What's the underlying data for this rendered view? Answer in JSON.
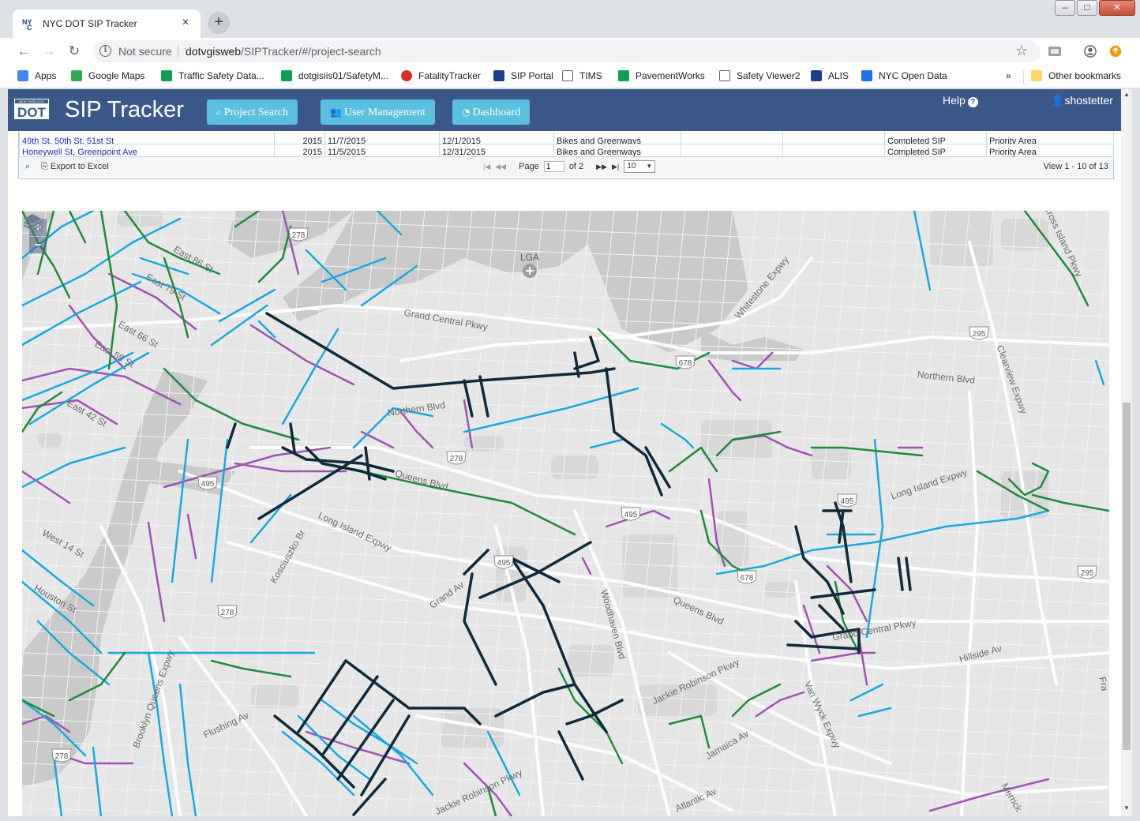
{
  "browser": {
    "tab_title": "NYC DOT SIP Tracker",
    "tab_close": "×",
    "new_tab": "+",
    "window_controls": {
      "minimize": "–",
      "maximize": "□",
      "close": "✕"
    },
    "security_label": "Not secure",
    "url_host": "dotvgisweb",
    "url_path": "/SIPTracker/#/project-search",
    "bookmarks": [
      {
        "label": "Apps",
        "icon": "apps-grid-icon",
        "color": "#4285f4"
      },
      {
        "label": "Google Maps",
        "icon": "google-maps-icon",
        "color": "#34a853"
      },
      {
        "label": "Traffic Safety Data...",
        "icon": "traffic-icon",
        "color": "#0f9d58"
      },
      {
        "label": "dotgisiis01/SafetyM...",
        "icon": "traffic-icon",
        "color": "#0f9d58"
      },
      {
        "label": "FatalityTracker",
        "icon": "fatality-tracker-icon",
        "color": "#d93025"
      },
      {
        "label": "SIP Portal",
        "icon": "nyc-icon",
        "color": "#1a3e8c"
      },
      {
        "label": "TIMS",
        "icon": "page-icon",
        "color": "#ffffff"
      },
      {
        "label": "PavementWorks",
        "icon": "pavement-icon",
        "color": "#0f9d58"
      },
      {
        "label": "Safety Viewer2",
        "icon": "page-icon",
        "color": "#ffffff"
      },
      {
        "label": "ALIS",
        "icon": "alis-icon",
        "color": "#1a3e8c"
      },
      {
        "label": "NYC Open Data",
        "icon": "open-data-icon",
        "color": "#1a73e8"
      }
    ],
    "bookmarks_more": "»",
    "other_bookmarks": "Other bookmarks"
  },
  "app": {
    "logo_top": "NEW YORK CITY",
    "logo_main": "DOT",
    "title": "SIP Tracker",
    "nav": [
      {
        "label": "Project Search",
        "icon": "search-icon"
      },
      {
        "label": "User Management",
        "icon": "users-icon"
      },
      {
        "label": "Dashboard",
        "icon": "dashboard-icon"
      }
    ],
    "help_label": "Help",
    "user_name": "shostetter"
  },
  "grid": {
    "rows": [
      {
        "name": "49th St, 50th St, 51st St",
        "year": "2015",
        "start": "11/7/2015",
        "end": "12/1/2015",
        "type": "Bikes and Greenways",
        "c6": "",
        "c7": "",
        "status": "Completed SIP",
        "area": "Priority Area"
      },
      {
        "name": "Honeywell St, Greenpoint Ave",
        "year": "2015",
        "start": "11/5/2015",
        "end": "12/31/2015",
        "type": "Bikes and Greenways",
        "c6": "",
        "c7": "",
        "status": "Completed SIP",
        "area": "Priority Area"
      }
    ],
    "pager": {
      "export_label": "Export to Excel",
      "page_label": "Page",
      "page_value": "1",
      "of_label": "of 2",
      "rows_per_page": "10",
      "view_label": "View 1 - 10 of 13"
    }
  },
  "map": {
    "zoom_in": "+",
    "zoom_out": "−",
    "colors": {
      "background": "#e6e6e6",
      "water": "#c9c9c9",
      "park": "#d8d8d8",
      "road": "#ffffff",
      "dark_project": "#0e2a3b",
      "blue_project": "#16a8e0",
      "green_project": "#1e8a3a",
      "purple_project": "#a050b4"
    },
    "labels": [
      {
        "text": "LGA",
        "kind": "airport"
      },
      {
        "text": "Grand Central Pkwy"
      },
      {
        "text": "Whitestone Expwy"
      },
      {
        "text": "Northern Blvd"
      },
      {
        "text": "Northern Blvd"
      },
      {
        "text": "Clearview Expwy"
      },
      {
        "text": "Cross Island Pkwy"
      },
      {
        "text": "Queens Blvd"
      },
      {
        "text": "Long Island Expwy"
      },
      {
        "text": "Long Island Expwy"
      },
      {
        "text": "Kosciuszko Br"
      },
      {
        "text": "Grand Av"
      },
      {
        "text": "Woodhaven Blvd"
      },
      {
        "text": "Queens Blvd"
      },
      {
        "text": "Grand Central Pkwy"
      },
      {
        "text": "Hillside Av"
      },
      {
        "text": "Jackie Robinson Pkwy"
      },
      {
        "text": "Van Wyck Expwy"
      },
      {
        "text": "Jamaica Av"
      },
      {
        "text": "Atlantic Av"
      },
      {
        "text": "Brooklyn Queens Expwy"
      },
      {
        "text": "Flushing Av"
      },
      {
        "text": "Jackie Robinson Pkwy"
      },
      {
        "text": "East 86 St"
      },
      {
        "text": "East 79 St"
      },
      {
        "text": "East 66 St"
      },
      {
        "text": "East 59 St"
      },
      {
        "text": "East 42 St"
      },
      {
        "text": "West 14 St"
      },
      {
        "text": "Houston St"
      },
      {
        "text": "Merrick"
      },
      {
        "text": "Fra"
      }
    ],
    "shields": [
      "278",
      "678",
      "295",
      "278",
      "495",
      "495",
      "495",
      "495",
      "678",
      "295",
      "278",
      "278"
    ]
  }
}
